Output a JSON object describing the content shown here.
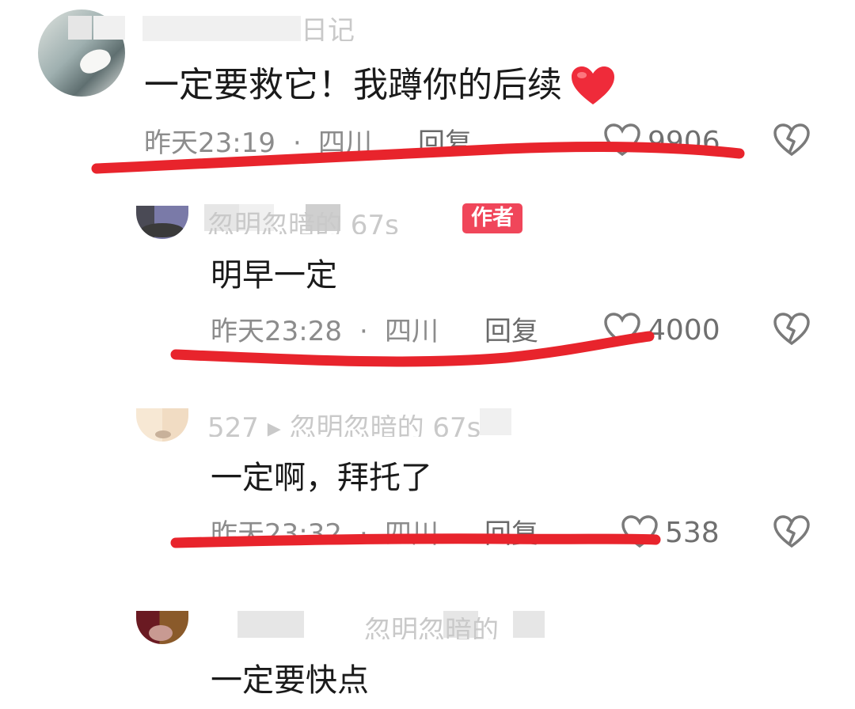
{
  "comments": [
    {
      "name": "日记",
      "text": "一定要救它！我蹲你的后续",
      "time": "昨天23:19",
      "sep": "·",
      "location": "四川",
      "reply": "回复",
      "likes": "9906"
    },
    {
      "name": "忽明忽暗的 67s",
      "author_badge": "作者",
      "text": "明早一定",
      "time": "昨天23:28",
      "sep": "·",
      "location": "四川",
      "reply": "回复",
      "likes": "4000"
    },
    {
      "name": "527 ▸ 忽明忽暗的 67s",
      "text": "一定啊，拜托了",
      "time": "昨天23:32",
      "sep": "·",
      "location": "四川",
      "reply": "回复",
      "likes": "538"
    },
    {
      "name": "忽明忽暗的",
      "text": "一定要快点"
    }
  ],
  "icons": {
    "like": "heart-outline-icon",
    "dislike": "broken-heart-icon",
    "emoji": "red-heart-emoji"
  },
  "colors": {
    "author_badge": "#f0465a",
    "annotation_line": "#e8242c",
    "meta_text": "#8c8c8c"
  }
}
